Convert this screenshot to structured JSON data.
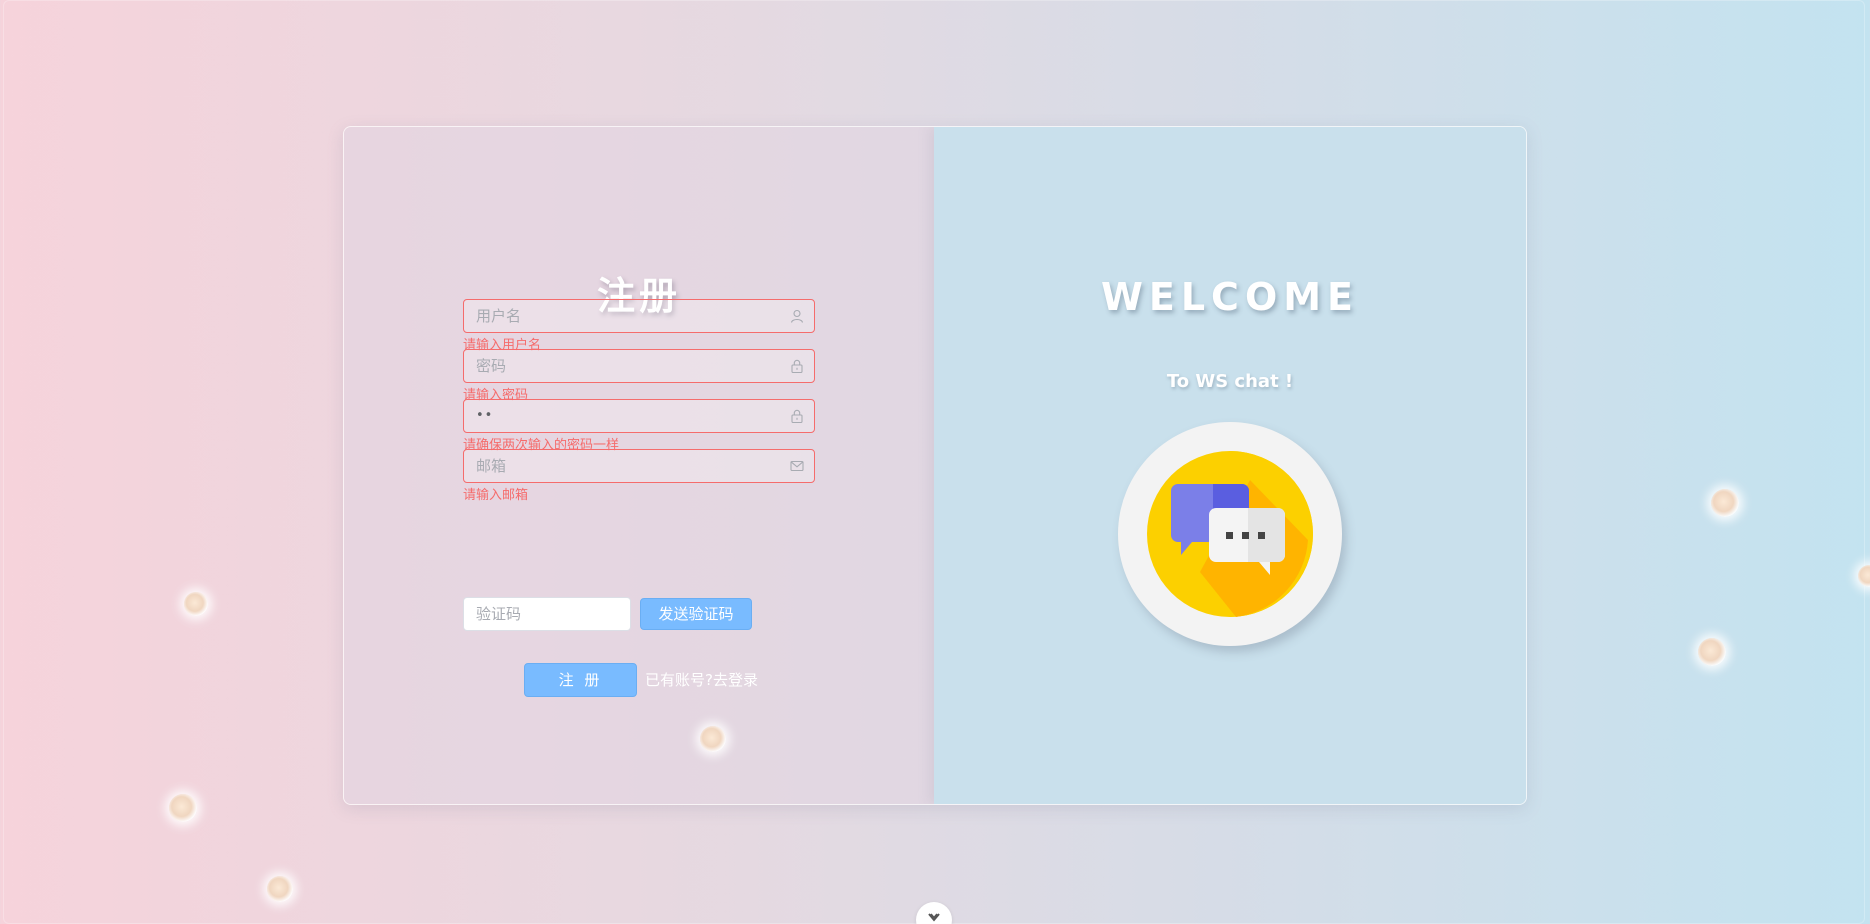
{
  "register": {
    "title": "注册",
    "username": {
      "placeholder": "用户名",
      "error": "请输入用户名",
      "icon": "user-icon"
    },
    "password": {
      "placeholder": "密码",
      "error": "请输入密码",
      "icon": "lock-icon"
    },
    "confirm_password": {
      "value": "••",
      "error": "请确保两次输入的密码一样",
      "icon": "lock-icon"
    },
    "email": {
      "placeholder": "邮箱",
      "error": "请输入邮箱",
      "icon": "mail-icon"
    },
    "code": {
      "placeholder": "验证码"
    },
    "send_code_label": "发送验证码",
    "submit_label": "注 册",
    "login_link": "已有账号?去登录"
  },
  "welcome": {
    "title": "WELCOME",
    "subtitle": "To WS chat !",
    "logo_icon": "chat-bubbles-icon"
  },
  "colors": {
    "error": "#f56c6c",
    "primary": "#79bbff",
    "logo_yellow": "#fcd000",
    "logo_shadow": "#ffb400",
    "bubble_purple": "#7b7fe8",
    "bubble_white": "#f2f2f2"
  }
}
